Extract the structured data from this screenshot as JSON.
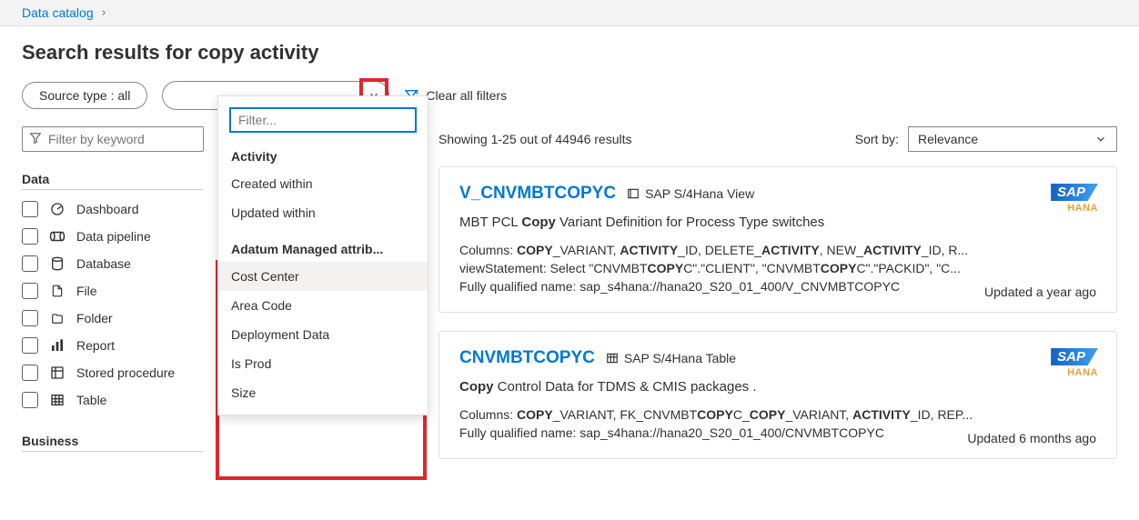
{
  "breadcrumb": {
    "root": "Data catalog"
  },
  "page_title": "Search results for copy activity",
  "filters": {
    "source_type_label": "Source type : all",
    "clear_all": "Clear all filters",
    "filter_keyword_placeholder": "Filter by keyword"
  },
  "dropdown": {
    "filter_placeholder": "Filter...",
    "group1_label": "Activity",
    "group1_options": {
      "created": "Created within",
      "updated": "Updated within"
    },
    "group2_label": "Adatum Managed attrib...",
    "group2_options": {
      "cost_center": "Cost Center",
      "area_code": "Area Code",
      "deployment_data": "Deployment Data",
      "is_prod": "Is Prod",
      "size": "Size"
    }
  },
  "facets": {
    "data_heading": "Data",
    "items": {
      "dashboard": "Dashboard",
      "data_pipeline": "Data pipeline",
      "database": "Database",
      "file": "File",
      "folder": "Folder",
      "report": "Report",
      "stored_procedure": "Stored procedure",
      "table": "Table"
    },
    "business_heading": "Business"
  },
  "results_header": {
    "showing": "Showing 1-25 out of 44946 results",
    "sort_label": "Sort by:",
    "sort_value": "Relevance"
  },
  "results": [
    {
      "title": "V_CNVMBTCOPYC",
      "type": "SAP S/4Hana View",
      "badge": "SAP",
      "badge_sub": "HANA",
      "desc_pre": "MBT PCL ",
      "desc_bold": "Copy",
      "desc_post": " Variant Definition for Process Type switches",
      "columns_label": "Columns: ",
      "columns_html": "<b>COPY</b>_VARIANT, <b>ACTIVITY</b>_ID, DELETE_<b>ACTIVITY</b>, NEW_<b>ACTIVITY</b>_ID, R...",
      "view_label": "viewStatement: ",
      "view_html": "Select \"CNVMBT<b>COPY</b>C\".\"CLIENT\", \"CNVMBT<b>COPY</b>C\".\"PACKID\", \"C...",
      "fqn_label": "Fully qualified name: ",
      "fqn": "sap_s4hana://hana20_S20_01_400/V_CNVMBTCOPYC",
      "updated": "Updated a year ago"
    },
    {
      "title": "CNVMBTCOPYC",
      "type": "SAP S/4Hana Table",
      "badge": "SAP",
      "badge_sub": "HANA",
      "desc_bold": "Copy",
      "desc_post": " Control Data for TDMS & CMIS packages .",
      "columns_label": "Columns: ",
      "columns_html": "<b>COPY</b>_VARIANT, FK_CNVMBT<b>COPY</b>C_<b>COPY</b>_VARIANT, <b>ACTIVITY</b>_ID, REP...",
      "fqn_label": "Fully qualified name: ",
      "fqn": "sap_s4hana://hana20_S20_01_400/CNVMBTCOPYC",
      "updated": "Updated 6 months ago"
    }
  ]
}
